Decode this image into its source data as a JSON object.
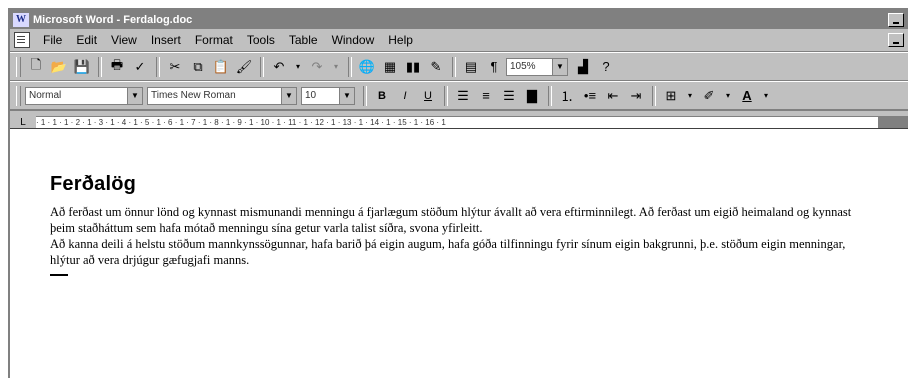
{
  "window": {
    "title": "Microsoft Word - Ferdalog.doc",
    "app_icon": "word-icon"
  },
  "menubar": {
    "items": [
      "File",
      "Edit",
      "View",
      "Insert",
      "Format",
      "Tools",
      "Table",
      "Window",
      "Help"
    ]
  },
  "toolbar_standard": {
    "zoom": "105%",
    "icons": [
      "new-icon",
      "open-icon",
      "save-icon",
      "print-icon",
      "cut-icon",
      "copy-icon",
      "paste-icon",
      "undo-icon",
      "redo-icon",
      "hyperlink-icon",
      "table-icon",
      "columns-icon",
      "pilcrow-icon",
      "help-icon"
    ]
  },
  "toolbar_formatting": {
    "style": "Normal",
    "font": "Times New Roman",
    "size": "10",
    "bold": "B",
    "italic": "I",
    "underline": "U",
    "font_color": "A"
  },
  "ruler": {
    "tab_selector": "L",
    "numbers": "· 1 · 1 · 1 · 2 · 1 · 3 · 1 · 4 · 1 · 5 · 1 · 6 · 1 · 7 · 1 · 8 · 1 · 9 · 1 · 10 · 1 · 11 · 1 · 12 · 1 · 13 · 1 · 14 · 1 · 15 · 1 · 16 · 1"
  },
  "document": {
    "heading": "Ferðalög",
    "paragraphs": [
      "Að ferðast um önnur lönd og kynnast mismunandi menningu á fjarlægum stöðum hlýtur ávallt að vera eftirminnilegt. Að ferðast um eigið heimaland og kynnast þeim staðháttum sem hafa mótað menningu sína getur varla talist síðra, svona yfirleitt.",
      "Að kanna deili á helstu stöðum mannkynssögunnar, hafa barið þá eigin augum, hafa góða tilfinningu fyrir sínum eigin bakgrunni, þ.e. stöðum eigin menningar, hlýtur að vera drjúgur gæfugjafi manns."
    ]
  }
}
